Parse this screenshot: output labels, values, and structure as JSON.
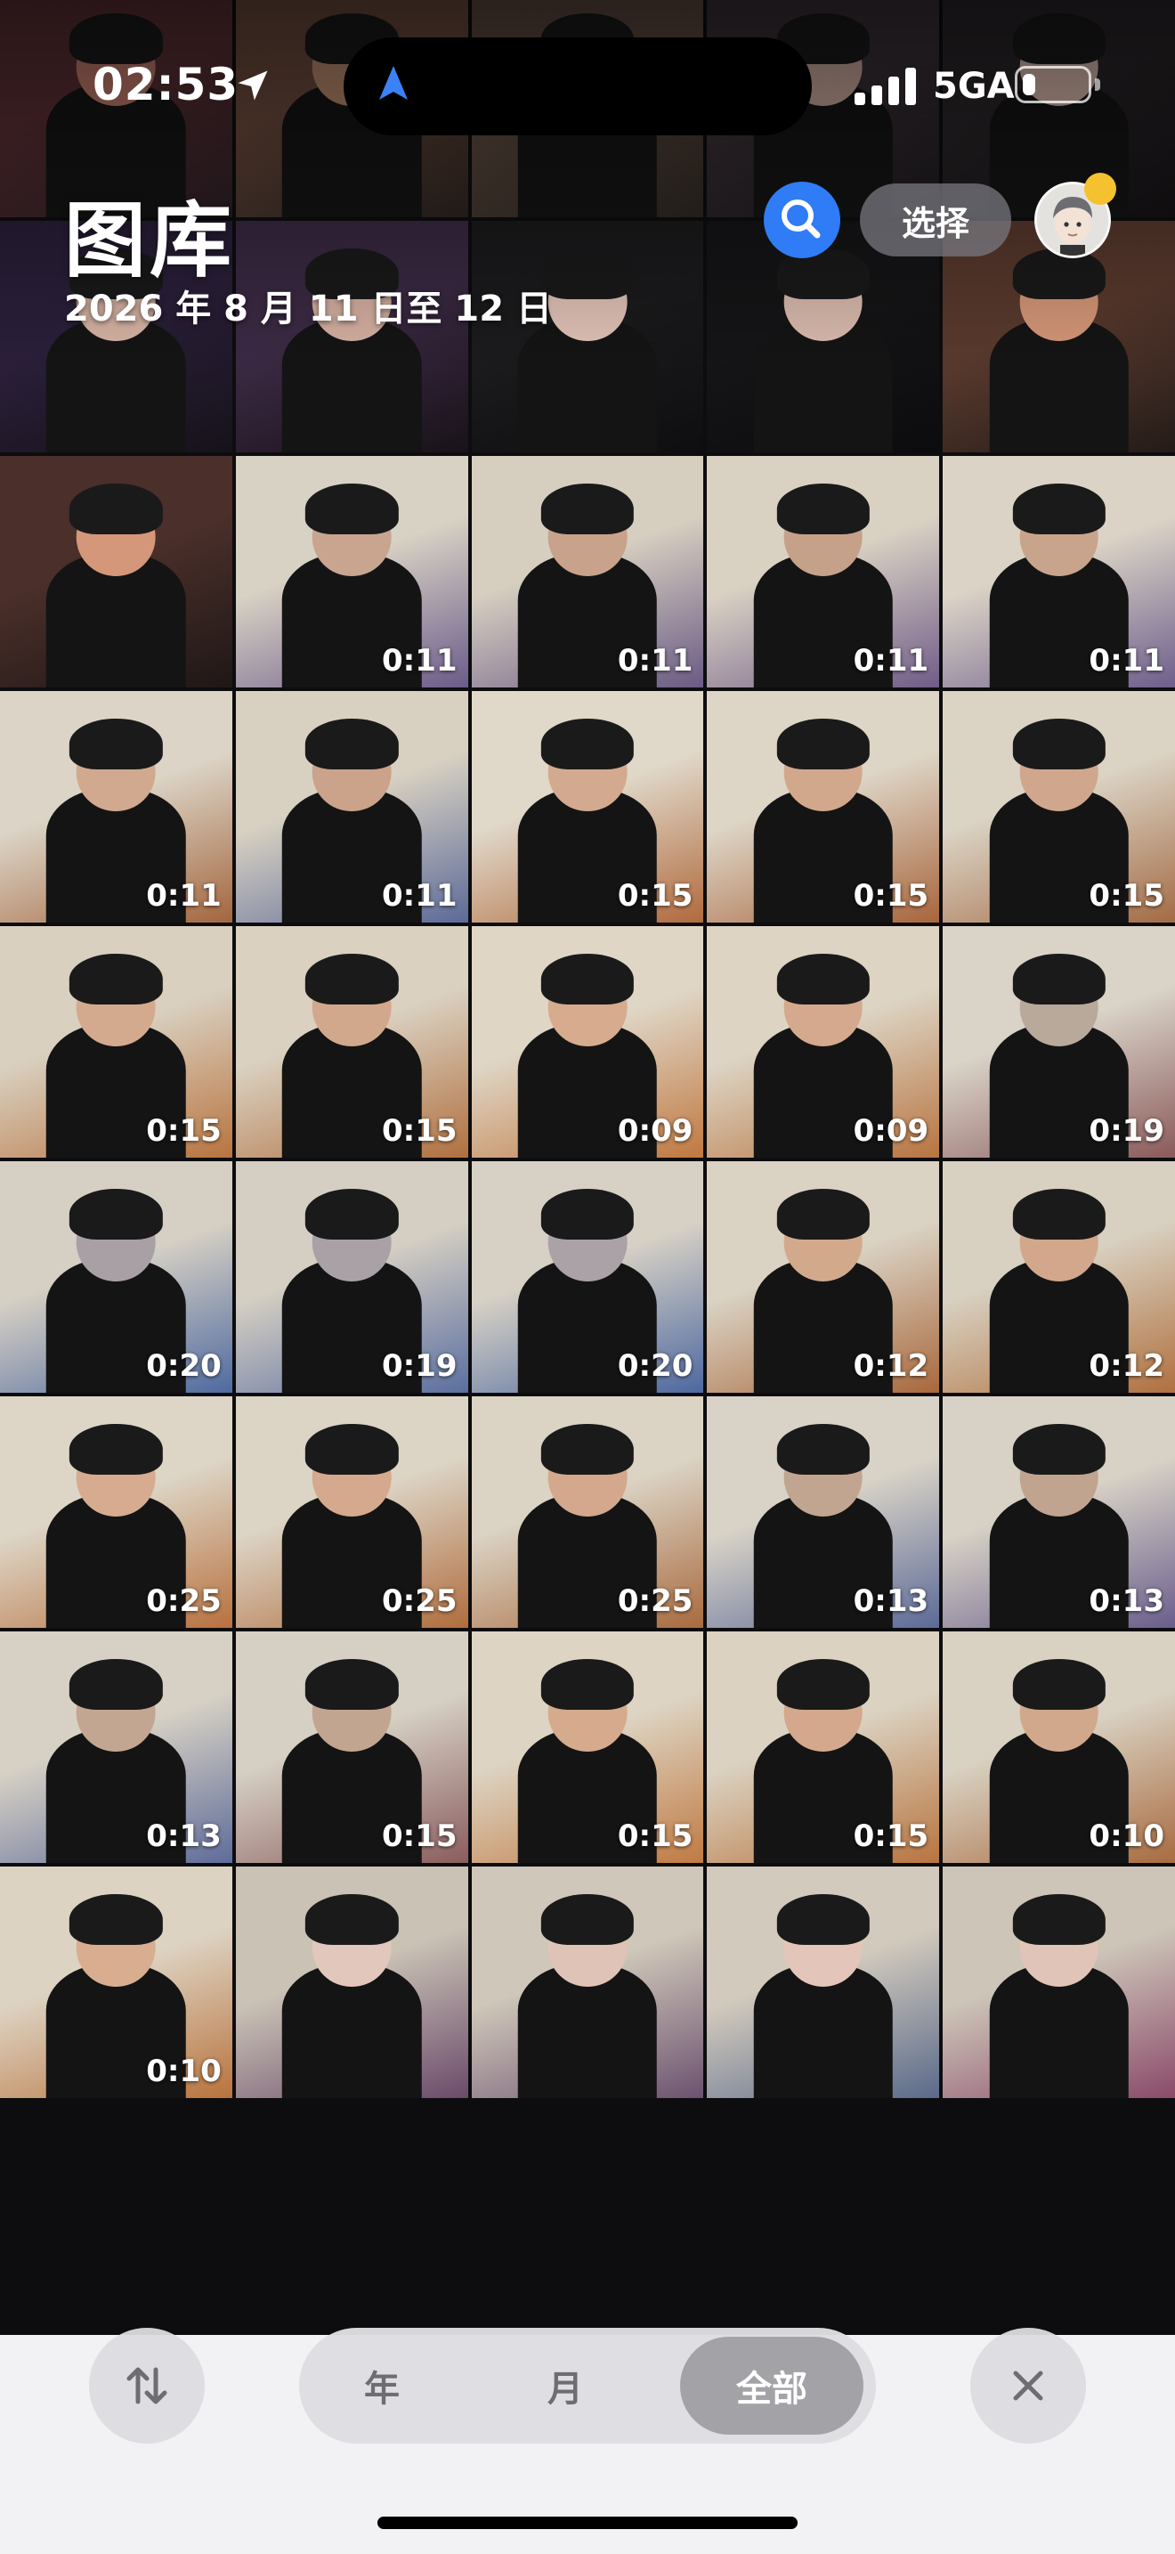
{
  "status_bar": {
    "time": "02:53",
    "network": "5GA",
    "location_icon": "location-arrow-icon",
    "signal_icon": "cellular-signal-icon",
    "battery_icon": "battery-icon",
    "battery_level": 0.2
  },
  "header": {
    "title": "图库",
    "date_range": "2026 年 8 月 11 日至 12 日",
    "search_icon": "search-icon",
    "select_label": "选择",
    "avatar_icon": "memoji-avatar-icon"
  },
  "grid": {
    "items": [
      {
        "duration": "",
        "palette": [
          "#5a2f33",
          "#c07a6a",
          "#2a1e24"
        ]
      },
      {
        "duration": "",
        "palette": [
          "#6b4a3c",
          "#b98a6c",
          "#2b2320"
        ]
      },
      {
        "duration": "",
        "palette": [
          "#5d4a40",
          "#b58b72",
          "#2d2722"
        ]
      },
      {
        "duration": "",
        "palette": [
          "#3a3036",
          "#c9a89c",
          "#1b181c"
        ]
      },
      {
        "duration": "",
        "palette": [
          "#2a2529",
          "#d7b8ab",
          "#141214"
        ]
      },
      {
        "duration": "",
        "palette": [
          "#2b1f3a",
          "#d9b5a5",
          "#161219"
        ]
      },
      {
        "duration": "",
        "palette": [
          "#3b2a44",
          "#d6b1a2",
          "#191219"
        ]
      },
      {
        "duration": "",
        "palette": [
          "#1b1a1c",
          "#e3c4b8",
          "#0e0e10"
        ]
      },
      {
        "duration": "",
        "palette": [
          "#151416",
          "#dcbcaf",
          "#0c0b0d"
        ]
      },
      {
        "duration": "",
        "palette": [
          "#5a3a2e",
          "#d79879",
          "#231b18"
        ]
      },
      {
        "duration": "",
        "palette": [
          "#4a2f2a",
          "#d4977a",
          "#1f1716"
        ]
      },
      {
        "duration": "0:11",
        "palette": [
          "#d8d2c4",
          "#c9a58f",
          "#6b5b8a"
        ]
      },
      {
        "duration": "0:11",
        "palette": [
          "#d6cfc0",
          "#c8a28a",
          "#6a5a84"
        ]
      },
      {
        "duration": "0:11",
        "palette": [
          "#d9d2c3",
          "#c6a189",
          "#705c88"
        ]
      },
      {
        "duration": "0:11",
        "palette": [
          "#dbd4c6",
          "#c9a48c",
          "#6d5e8c"
        ]
      },
      {
        "duration": "0:11",
        "palette": [
          "#dcd5c7",
          "#d0a98f",
          "#a3663e"
        ]
      },
      {
        "duration": "0:11",
        "palette": [
          "#d8d1c2",
          "#caa38a",
          "#5c6a98"
        ]
      },
      {
        "duration": "0:15",
        "palette": [
          "#e0d8c9",
          "#d3aa8f",
          "#b06a3d"
        ]
      },
      {
        "duration": "0:15",
        "palette": [
          "#ddd5c6",
          "#d2a88d",
          "#a8653c"
        ]
      },
      {
        "duration": "0:15",
        "palette": [
          "#dbd3c4",
          "#d0a78c",
          "#a36b45"
        ]
      },
      {
        "duration": "0:15",
        "palette": [
          "#d9d0c0",
          "#d4aa8f",
          "#b8743f"
        ]
      },
      {
        "duration": "0:15",
        "palette": [
          "#dad1c1",
          "#d2a88d",
          "#b0703f"
        ]
      },
      {
        "duration": "0:09",
        "palette": [
          "#dfd6c6",
          "#d6ab8e",
          "#c07840"
        ]
      },
      {
        "duration": "0:09",
        "palette": [
          "#ddd4c4",
          "#d4a98d",
          "#b87440"
        ]
      },
      {
        "duration": "0:19",
        "palette": [
          "#d9d3c8",
          "#b9a99a",
          "#8a5a5a"
        ]
      },
      {
        "duration": "0:20",
        "palette": [
          "#d6d0c4",
          "#a9a0a6",
          "#4f6aa0"
        ]
      },
      {
        "duration": "0:19",
        "palette": [
          "#d5cfc3",
          "#aaa1a7",
          "#5a6ea0"
        ]
      },
      {
        "duration": "0:20",
        "palette": [
          "#d7d1c5",
          "#aba2a8",
          "#4d68a0"
        ]
      },
      {
        "duration": "0:12",
        "palette": [
          "#dad2c3",
          "#d3a98c",
          "#a8683c"
        ]
      },
      {
        "duration": "0:12",
        "palette": [
          "#d8d0c0",
          "#d2a78b",
          "#b0703e"
        ]
      },
      {
        "duration": "0:25",
        "palette": [
          "#ddd6c7",
          "#d6ab8f",
          "#b8713f"
        ]
      },
      {
        "duration": "0:25",
        "palette": [
          "#dcd4c5",
          "#d4a98d",
          "#b06d3e"
        ]
      },
      {
        "duration": "0:25",
        "palette": [
          "#dbd3c4",
          "#d3a88c",
          "#a86a3e"
        ]
      },
      {
        "duration": "0:13",
        "palette": [
          "#d9d3c7",
          "#c1a591",
          "#5c6a98"
        ]
      },
      {
        "duration": "0:13",
        "palette": [
          "#d8d2c6",
          "#c0a490",
          "#6a5e8c"
        ]
      },
      {
        "duration": "0:13",
        "palette": [
          "#d7d1c5",
          "#c3a692",
          "#5f6c9a"
        ]
      },
      {
        "duration": "0:15",
        "palette": [
          "#d6d0c4",
          "#c2a591",
          "#8a5d5d"
        ]
      },
      {
        "duration": "0:15",
        "palette": [
          "#ddd4c3",
          "#d5aa8d",
          "#c07a42"
        ]
      },
      {
        "duration": "0:15",
        "palette": [
          "#dbd2c1",
          "#d3a88c",
          "#b8743f"
        ]
      },
      {
        "duration": "0:10",
        "palette": [
          "#d9d1c2",
          "#d2a88c",
          "#a86b40"
        ]
      },
      {
        "duration": "0:10",
        "palette": [
          "#ddd3c2",
          "#d8ad90",
          "#b8733d"
        ]
      },
      {
        "duration": "",
        "palette": [
          "#c9c2b5",
          "#e2c7bd",
          "#6a4a6a"
        ]
      },
      {
        "duration": "",
        "palette": [
          "#cfc7b9",
          "#e0c3b7",
          "#6c5270"
        ]
      },
      {
        "duration": "",
        "palette": [
          "#d2cabd",
          "#e3c6b9",
          "#5a6a8a"
        ]
      },
      {
        "duration": "",
        "palette": [
          "#cdc5b8",
          "#e1c4b8",
          "#8a4a6a"
        ]
      }
    ]
  },
  "bottom_bar": {
    "sort_icon": "sort-arrows-icon",
    "tabs": [
      {
        "label": "年",
        "active": false
      },
      {
        "label": "月",
        "active": false
      },
      {
        "label": "全部",
        "active": true
      }
    ],
    "close_icon": "close-icon"
  }
}
